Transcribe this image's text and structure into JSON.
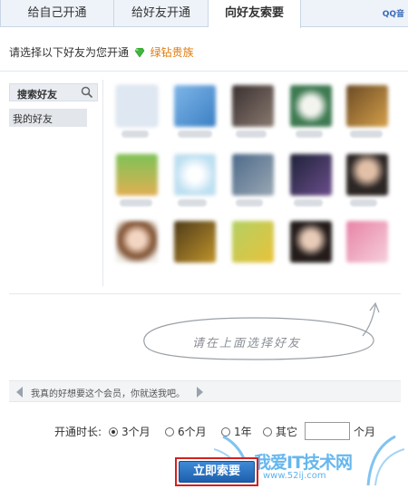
{
  "tabs": [
    {
      "label": "给自己开通"
    },
    {
      "label": "给好友开通"
    },
    {
      "label": "向好友索要"
    }
  ],
  "tab_right_label": "QQ音",
  "prompt": {
    "text": "请选择以下好友为您开通",
    "vip_label": "绿钻贵族"
  },
  "search": {
    "label": "搜索好友"
  },
  "friend_group": {
    "label": "我的好友"
  },
  "hint_text": "请在上面选择好友",
  "message": "我真的好想要这个会员，你就送我吧。",
  "duration": {
    "label": "开通时长:",
    "options": [
      "3个月",
      "6个月",
      "1年",
      "其它"
    ],
    "selected": "3个月",
    "other_value": "",
    "unit": "个月"
  },
  "submit_label": "立即索要",
  "watermark": {
    "title": "我爱IT技术网",
    "url": "www.52ij.com"
  },
  "colors": {
    "vip": "#e07a0a",
    "submit": "#2a6fc0",
    "highlight_border": "#d61f1f"
  },
  "icons": {
    "search": "magnifier-icon",
    "vip": "green-diamond-icon"
  }
}
